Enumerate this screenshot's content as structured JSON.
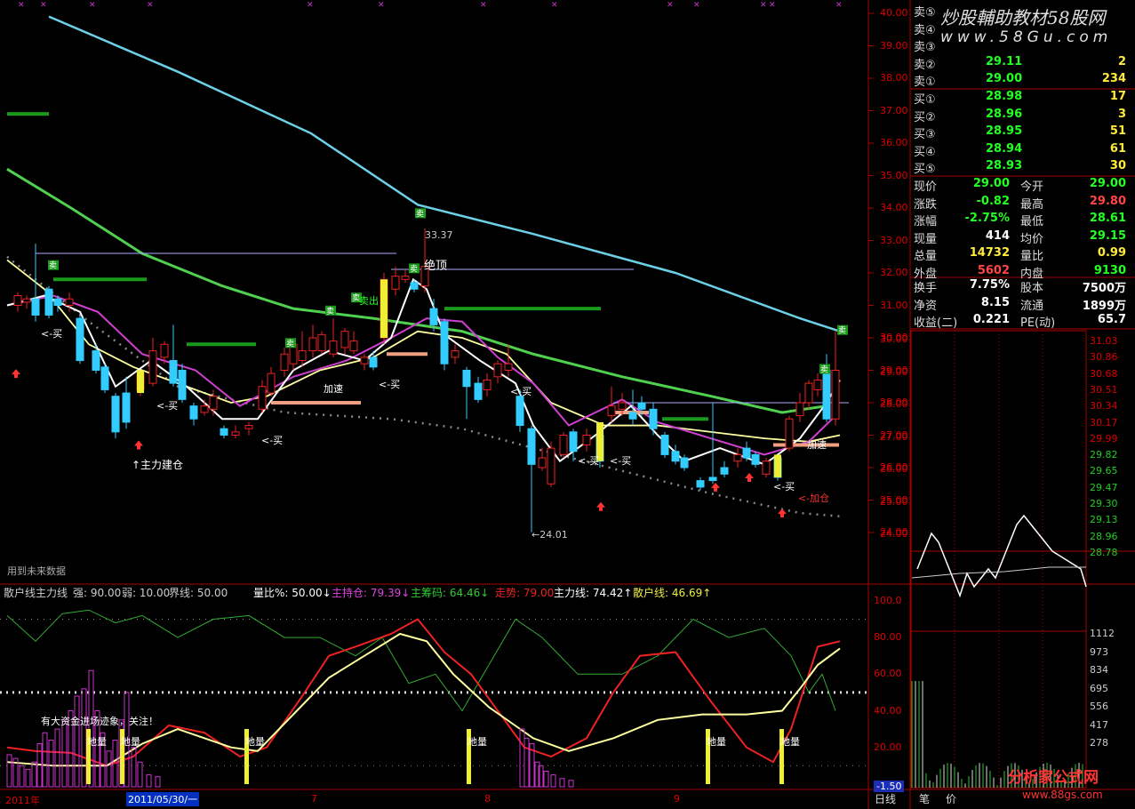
{
  "watermark": {
    "top": "炒股輔助教材58股网",
    "url": "www.58Gu.com",
    "bottom_site": "分析家公式网",
    "bottom_url": "www.88gs.com"
  },
  "main": {
    "price_axis": [
      "40.00",
      "39.00",
      "38.00",
      "37.00",
      "36.00",
      "35.00",
      "34.00",
      "33.00",
      "32.00",
      "31.00",
      "30.00",
      "29.00",
      "28.00",
      "27.00",
      "26.00",
      "25.00",
      "24.00"
    ],
    "annotations": {
      "high": "33.37",
      "low": "←24.01",
      "top_mark": "绝顶",
      "sell_out": "卖出",
      "accel1": "加速",
      "accel2": "加速",
      "add_pos": "<-加仓",
      "build": "↑主力建仓",
      "buy": "<-买",
      "note": "用到未来数据"
    },
    "sell_badge": "卖"
  },
  "indicator": {
    "title": "散户线主力线",
    "strong": "强: 90.00",
    "weak": "弱: 10.00",
    "boundary": "界线: 50.00",
    "ratio": "量比%: 50.00↓",
    "hold": "主持仓: 79.39↓",
    "chips": "主筹码: 64.46↓",
    "trend": "走势: 79.00",
    "main_line": "主力线: 74.42↑",
    "retail_line": "散户线: 46.69↑",
    "axis": [
      "100.0",
      "80.00",
      "60.00",
      "40.00",
      "20.00",
      "-1.50"
    ],
    "notice": "有大资金进场迹象，关注！",
    "bottom_label": "地量"
  },
  "dates": [
    "2011年",
    "2011/05/30/一",
    "7",
    "8",
    "9"
  ],
  "quote": {
    "asks": [
      {
        "label": "卖⑤",
        "price": "",
        "vol": ""
      },
      {
        "label": "卖④",
        "price": "",
        "vol": ""
      },
      {
        "label": "卖③",
        "price": "",
        "vol": ""
      },
      {
        "label": "卖②",
        "price": "29.11",
        "vol": "2"
      },
      {
        "label": "卖①",
        "price": "29.00",
        "vol": "234"
      }
    ],
    "bids": [
      {
        "label": "买①",
        "price": "28.98",
        "vol": "17"
      },
      {
        "label": "买②",
        "price": "28.96",
        "vol": "3"
      },
      {
        "label": "买③",
        "price": "28.95",
        "vol": "51"
      },
      {
        "label": "买④",
        "price": "28.94",
        "vol": "61"
      },
      {
        "label": "买⑤",
        "price": "28.93",
        "vol": "30"
      }
    ],
    "stats": [
      {
        "l1": "现价",
        "v1": "29.00",
        "l2": "今开",
        "v2": "29.00"
      },
      {
        "l1": "涨跌",
        "v1": "-0.82",
        "l2": "最高",
        "v2": "29.80"
      },
      {
        "l1": "涨幅",
        "v1": "-2.75%",
        "l2": "最低",
        "v2": "28.61"
      },
      {
        "l1": "现量",
        "v1": "414",
        "l2": "均价",
        "v2": "29.15"
      },
      {
        "l1": "总量",
        "v1": "14732",
        "l2": "量比",
        "v2": "0.99"
      },
      {
        "l1": "外盘",
        "v1": "5602",
        "l2": "内盘",
        "v2": "9130"
      }
    ],
    "stats2": [
      {
        "l1": "换手",
        "v1": "7.75%",
        "l2": "股本",
        "v2": "7500万"
      },
      {
        "l1": "净资",
        "v1": "8.15",
        "l2": "流通",
        "v2": "1899万"
      },
      {
        "l1": "收益(二)",
        "v1": "0.221",
        "l2": "PE(动)",
        "v2": "65.7"
      }
    ]
  },
  "intraday": {
    "left_axis": [
      "30.00",
      "29.00",
      "28.00",
      "27.00",
      "26.00",
      "25.00",
      "24.00"
    ],
    "right_axis": [
      "31.03",
      "30.86",
      "30.68",
      "30.51",
      "30.34",
      "30.17",
      "29.99",
      "29.82",
      "29.65",
      "29.47",
      "29.30",
      "29.13",
      "28.96",
      "28.78"
    ],
    "vol_axis": [
      "1112",
      "973",
      "834",
      "695",
      "556",
      "417",
      "278"
    ]
  },
  "tabs": [
    "日线",
    "笔",
    "价"
  ]
}
